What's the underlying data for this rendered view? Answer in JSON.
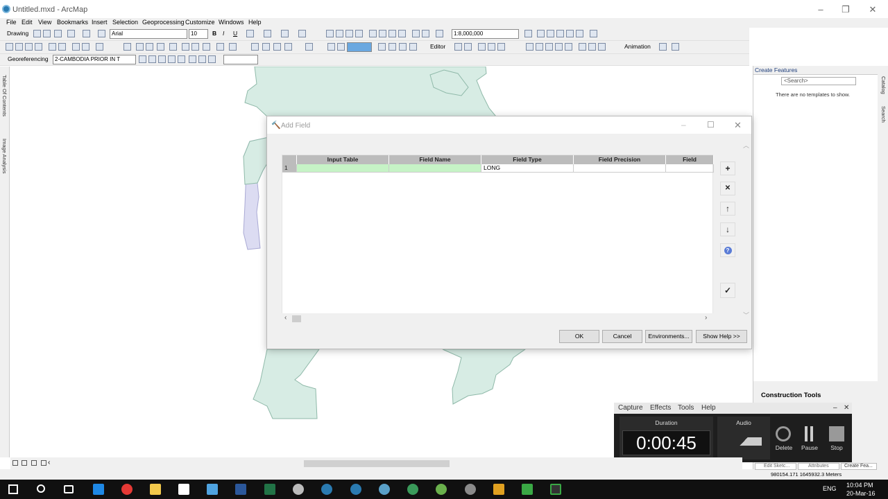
{
  "window": {
    "title": "Untitled.mxd - ArcMap"
  },
  "menu": [
    "File",
    "Edit",
    "View",
    "Bookmarks",
    "Insert",
    "Selection",
    "Geoprocessing",
    "Customize",
    "Windows",
    "Help"
  ],
  "toolbar1": {
    "drawing_label": "Drawing",
    "font_name": "Arial",
    "font_size": "10",
    "bold": "B",
    "italic": "I",
    "underline": "U",
    "scale": "1:8,000,000"
  },
  "toolbar2": {
    "editor_label": "Editor",
    "animation_label": "Animation"
  },
  "toolbar3": {
    "georef_label": "Georeferencing",
    "layer_value": "2-CAMBODIA PRIOR IN T"
  },
  "left_tabs": {
    "toc": "Table Of Contents",
    "image_analysis": "Image Analysis"
  },
  "right_tabs": {
    "catalog": "Catalog",
    "search": "Search"
  },
  "create_features": {
    "title": "Create Features",
    "search_placeholder": "<Search>",
    "empty_text": "There are no templates to show.",
    "construction_tools": "Construction Tools"
  },
  "dialog": {
    "title": "Add Field",
    "columns": [
      "Input Table",
      "Field Name",
      "Field Type",
      "Field Precision",
      "Field"
    ],
    "rows": [
      {
        "num": "1",
        "input_table": "",
        "field_name": "",
        "field_type": "LONG",
        "field_precision": "",
        "field": ""
      }
    ],
    "buttons": {
      "ok": "OK",
      "cancel": "Cancel",
      "environments": "Environments...",
      "show_help": "Show Help >>"
    }
  },
  "recorder": {
    "menu": [
      "Capture",
      "Effects",
      "Tools",
      "Help"
    ],
    "duration_label": "Duration",
    "audio_label": "Audio",
    "duration": "0:00:45",
    "delete": "Delete",
    "pause": "Pause",
    "stop": "Stop"
  },
  "statusbar": {
    "coords": "980154.171  1645932.3 Meters",
    "tab_edit_sketch": "Edit Sketc...",
    "tab_attributes": "Attributes",
    "tab_create_features": "Create Fea..."
  },
  "taskbar": {
    "lang": "ENG",
    "time": "10:04 PM",
    "date": "20-Mar-16"
  },
  "colors": {
    "map_fill": "#d7ece4",
    "map_stroke": "#8fb9a9",
    "map_fill2": "#dcdcf2",
    "row_green": "#c6f3c6",
    "header_gray": "#bcbcbc"
  }
}
